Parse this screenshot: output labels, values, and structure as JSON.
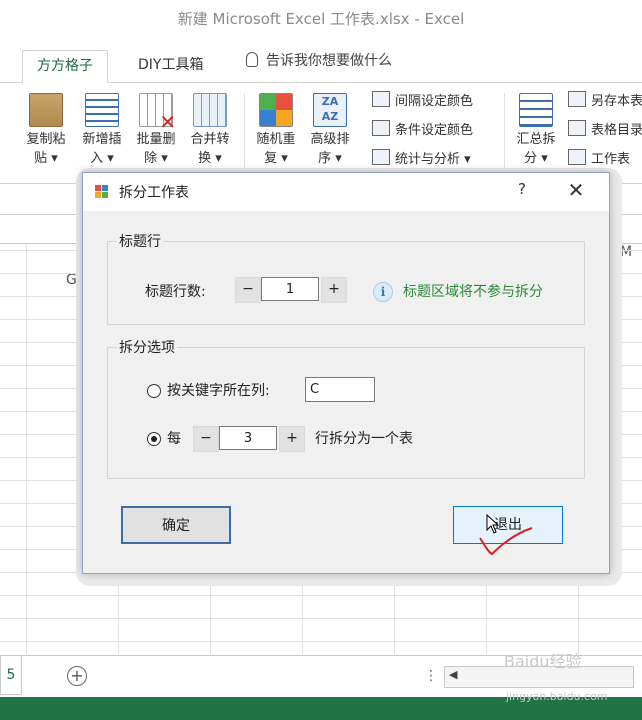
{
  "app": {
    "title": "新建 Microsoft Excel 工作表.xlsx - Excel"
  },
  "tabs": [
    {
      "label": "方方格子",
      "active": true
    },
    {
      "label": "DIY工具箱",
      "active": false
    }
  ],
  "tell_me": "告诉我你想要做什么",
  "ribbon": {
    "large_buttons": [
      {
        "l1": "复制粘",
        "l2": "贴 ▾",
        "icon": "clipboard-icon"
      },
      {
        "l1": "新增插",
        "l2": "入 ▾",
        "icon": "insert-rows-icon"
      },
      {
        "l1": "批量删",
        "l2": "除 ▾",
        "icon": "delete-table-icon"
      },
      {
        "l1": "合并转",
        "l2": "换 ▾",
        "icon": "merge-convert-icon"
      },
      {
        "l1": "随机重",
        "l2": "复 ▾",
        "icon": "random-repeat-icon"
      },
      {
        "l1": "高级排",
        "l2": "序 ▾",
        "icon": "sort-az-icon"
      },
      {
        "l1": "汇总拆",
        "l2": "分 ▾",
        "icon": "summary-split-icon"
      }
    ],
    "small_items": [
      {
        "label": "间隔设定颜色",
        "icon": "interval-color-icon"
      },
      {
        "label": "条件设定颜色",
        "icon": "condition-color-icon"
      },
      {
        "label": "统计与分析 ▾",
        "icon": "statistics-icon"
      },
      {
        "label": "另存本表",
        "icon": "save-sheet-icon"
      },
      {
        "label": "表格目录",
        "icon": "table-directory-icon"
      },
      {
        "label": "工作表",
        "icon": "worksheet-icon"
      }
    ]
  },
  "columns": [
    "G",
    "M"
  ],
  "sheet": {
    "tab_label": "5",
    "add_sheet": "+"
  },
  "dialog": {
    "title": "拆分工作表",
    "help": "?",
    "close": "✕",
    "header_group": {
      "label": "标题行",
      "rows_label": "标题行数:",
      "minus": "−",
      "value": "1",
      "plus": "+",
      "info_icon": "i",
      "hint": "标题区域将不参与拆分"
    },
    "split_group": {
      "label": "拆分选项",
      "option1_label": "按关键字所在列:",
      "option1_value": "C",
      "option1_selected": false,
      "option2_prefix": "每",
      "option2_minus": "−",
      "option2_value": "3",
      "option2_plus": "+",
      "option2_suffix": "行拆分为一个表",
      "option2_selected": true
    },
    "ok_label": "确定",
    "exit_label": "退出"
  },
  "watermark": {
    "logo": "Baidu经验",
    "url": "jingyan.baidu.com"
  },
  "colors": {
    "excel_green": "#217346",
    "hint_green": "#2a8a3a",
    "tab_green": "#1e6b40",
    "focus_border": "#3a6ea5",
    "check_red": "#e02020"
  }
}
